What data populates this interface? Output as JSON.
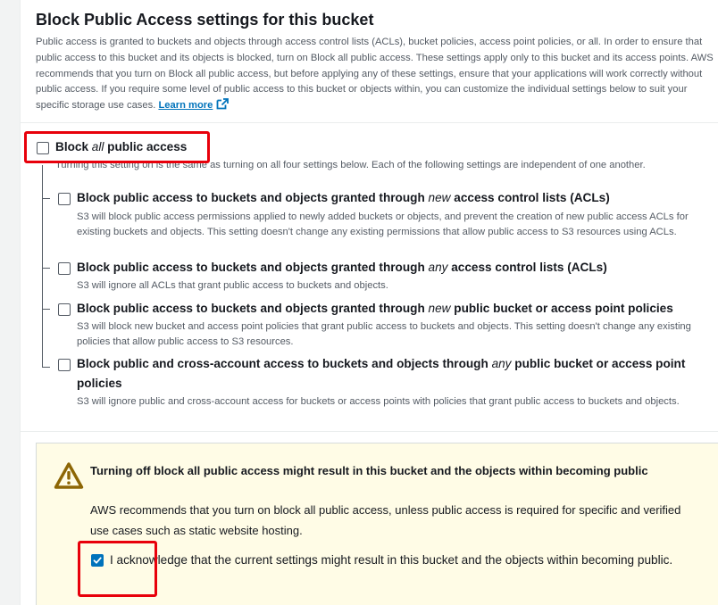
{
  "section": {
    "title": "Block Public Access settings for this bucket",
    "description": "Public access is granted to buckets and objects through access control lists (ACLs), bucket policies, access point policies, or all. In order to ensure that public access to this bucket and its objects is blocked, turn on Block all public access. These settings apply only to this bucket and its access points. AWS recommends that you turn on Block all public access, but before applying any of these settings, ensure that your applications will work correctly without public access. If you require some level of public access to this bucket or objects within, you can customize the individual settings below to suit your specific storage use cases.",
    "learn_more": "Learn more",
    "external_icon": "external-link-icon"
  },
  "block_all": {
    "label_pre": "Block ",
    "label_em": "all",
    "label_post": " public access",
    "description": "Turning this setting on is the same as turning on all four settings below. Each of the following settings are independent of one another.",
    "checked": false
  },
  "options": [
    {
      "label_pre": "Block public access to buckets and objects granted through ",
      "label_em": "new",
      "label_post": " access control lists (ACLs)",
      "description": "S3 will block public access permissions applied to newly added buckets or objects, and prevent the creation of new public access ACLs for existing buckets and objects. This setting doesn't change any existing permissions that allow public access to S3 resources using ACLs.",
      "checked": false
    },
    {
      "label_pre": "Block public access to buckets and objects granted through ",
      "label_em": "any",
      "label_post": " access control lists (ACLs)",
      "description": "S3 will ignore all ACLs that grant public access to buckets and objects.",
      "checked": false
    },
    {
      "label_pre": "Block public access to buckets and objects granted through ",
      "label_em": "new",
      "label_post": " public bucket or access point policies",
      "description": "S3 will block new bucket and access point policies that grant public access to buckets and objects. This setting doesn't change any existing policies that allow public access to S3 resources.",
      "checked": false
    },
    {
      "label_pre": "Block public and cross-account access to buckets and objects through ",
      "label_em": "any",
      "label_post": " public bucket or access point",
      "label_line2": "policies",
      "description": "S3 will ignore public and cross-account access for buckets or access points with policies that grant public access to buckets and objects.",
      "checked": false
    }
  ],
  "warning": {
    "icon": "warning-triangle-icon",
    "title": "Turning off block all public access might result in this bucket and the objects within becoming public",
    "body": "AWS recommends that you turn on block all public access, unless public access is required for specific and verified use cases such as static website hosting.",
    "ack_label": "I acknowledge that the current settings might result in this bucket and the objects within becoming public.",
    "ack_checked": true
  },
  "colors": {
    "link": "#0073bb",
    "highlight": "#e8000b",
    "warning_bg": "#fffce6",
    "checkbox_checked": "#0073bb"
  }
}
